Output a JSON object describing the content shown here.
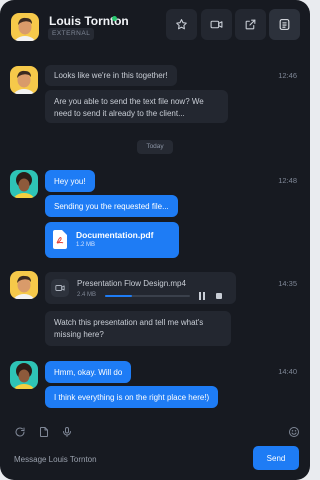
{
  "header": {
    "name": "Louis Tornton",
    "badge": "EXTERNAL",
    "status": "online",
    "actions": [
      {
        "id": "star",
        "icon": "star-icon"
      },
      {
        "id": "video",
        "icon": "video-call-icon"
      },
      {
        "id": "share",
        "icon": "share-icon"
      },
      {
        "id": "menu",
        "icon": "document-menu-icon"
      }
    ]
  },
  "messages": [
    {
      "sender": "Louis Tornton",
      "time": "12:46",
      "texts": [
        "Looks like we're in this together!",
        "Are you able to send the text file now? We need to send it already to the client..."
      ]
    },
    {
      "separator": "Today"
    },
    {
      "sender": "me",
      "time": "12:48",
      "texts": [
        "Hey you!",
        "Sending you the requested file..."
      ],
      "file": {
        "name": "Documentation.pdf",
        "size": "1.2 MB",
        "icon": "pdf-icon"
      }
    },
    {
      "sender": "Louis Tornton",
      "time": "14:35",
      "video": {
        "name": "Presentation Flow Design.mp4",
        "size": "2.4 MB",
        "progress": 0.32
      },
      "texts": [
        "Watch this presentation and tell me what's missing here?"
      ]
    },
    {
      "sender": "me",
      "time": "14:40",
      "texts": [
        "Hmm, okay. Will do",
        "I think everything is on the right place here!)"
      ]
    }
  ],
  "composer": {
    "placeholder": "Message Louis Tornton",
    "send_label": "Send",
    "tools": [
      "refresh-icon",
      "attachment-file-icon",
      "microphone-icon",
      "emoji-icon"
    ]
  },
  "colors": {
    "background": "#171a21",
    "bubble_incoming": "#232730",
    "bubble_outgoing": "#1e7cf5",
    "online": "#28c76f"
  }
}
